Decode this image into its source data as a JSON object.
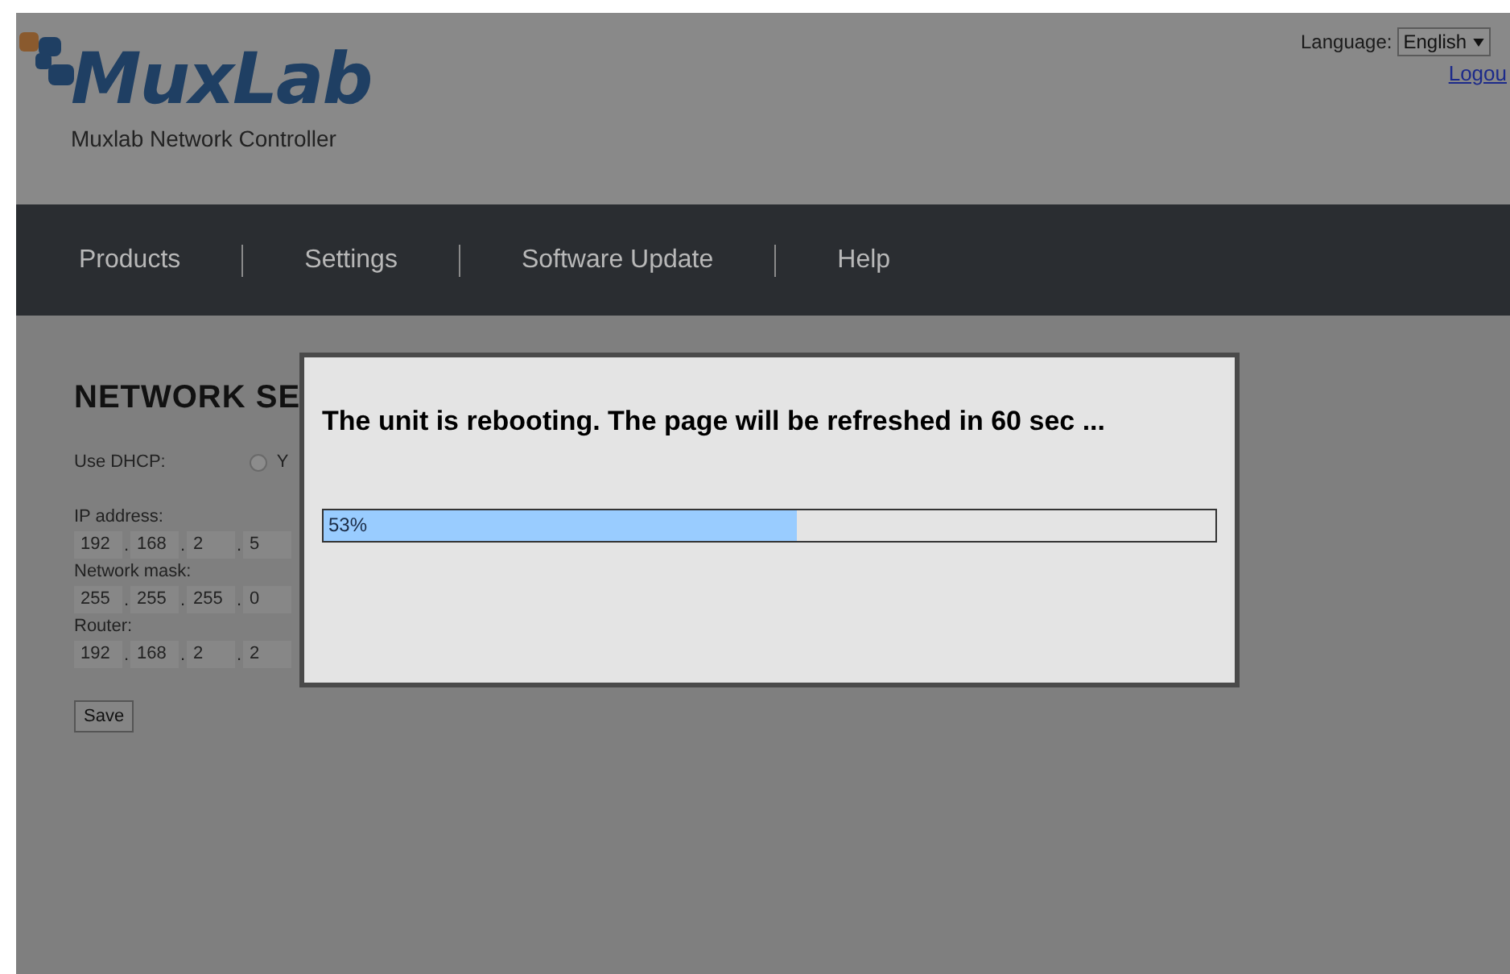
{
  "header": {
    "logo": "MuxLab",
    "subtitle": "Muxlab Network Controller",
    "language_label": "Language:",
    "language": "English",
    "logout": "Logou"
  },
  "nav": [
    {
      "label": "Products"
    },
    {
      "label": "Settings"
    },
    {
      "label": "Software Update"
    },
    {
      "label": "Help"
    }
  ],
  "form": {
    "title": "NETWORK SE",
    "dhcp_label": "Use DHCP:",
    "dhcp_option": {
      "label": "Y",
      "checked": false
    },
    "fields": [
      {
        "label": "IP address:",
        "octets": [
          "192",
          "168",
          "2",
          "5"
        ],
        "separators": [
          ".",
          ".",
          "."
        ]
      },
      {
        "label": "Network mask:",
        "octets": [
          "255",
          "255",
          "255",
          "0"
        ],
        "separators": [
          ".",
          ".",
          "."
        ]
      },
      {
        "label": "Router:",
        "octets": [
          "192",
          "168",
          "2",
          "2"
        ],
        "separators": [
          ".",
          ".",
          "."
        ]
      }
    ],
    "save": "Save"
  },
  "dialog": {
    "message": "The unit is rebooting. The page will be refreshed in 60 sec ...",
    "progress": {
      "text": "53%",
      "level": 0.53
    }
  }
}
